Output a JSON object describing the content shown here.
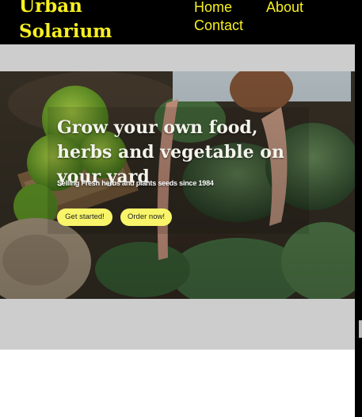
{
  "brand": {
    "line1": "Urban",
    "line2": "Solarium"
  },
  "nav": {
    "home": "Home",
    "about": "About",
    "contact": "Contact"
  },
  "hero": {
    "title": "Grow your own food, herbs and vegetable on your yard",
    "subtitle": "Selling Fresh herbs and plants seeds since 1984",
    "primary_button": "Get started!",
    "secondary_button": "Order now!"
  },
  "colors": {
    "accent": "#f7f020",
    "button": "#f8f56a",
    "navbar": "#000000",
    "band": "#cdcdcd"
  }
}
